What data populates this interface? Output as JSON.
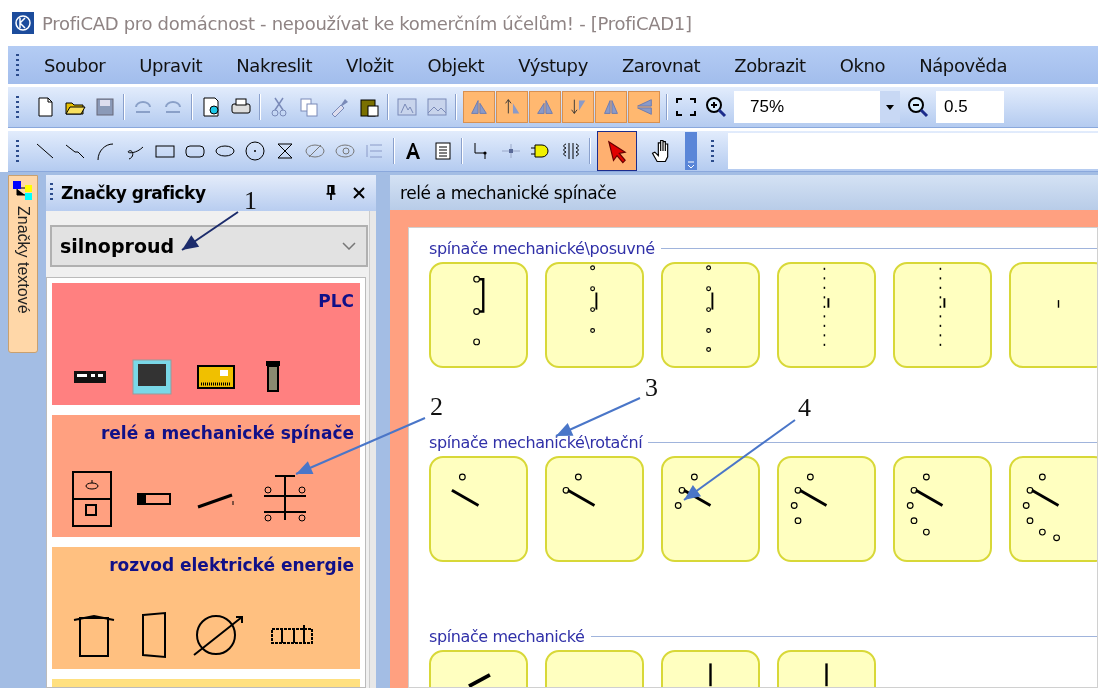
{
  "window": {
    "title": "ProfiCAD pro domácnost - nepoužívat ke komerčním účelům! - [ProfiCAD1]"
  },
  "menu": [
    "Soubor",
    "Upravit",
    "Nakreslit",
    "Vložit",
    "Objekt",
    "Výstupy",
    "Zarovnat",
    "Zobrazit",
    "Okno",
    "Nápověda"
  ],
  "zoom_combo": {
    "value": "75%"
  },
  "scale_field": {
    "value": "0.5"
  },
  "drawing_tools": [
    {
      "kind": "pointer",
      "selected": true
    },
    {
      "kind": "hand",
      "selected": false
    }
  ],
  "side_tab": {
    "label": "Značky textové"
  },
  "panel": {
    "title": "Značky graficky",
    "category_select": {
      "value": "silnoproud"
    },
    "groups": [
      {
        "label": "PLC",
        "color": "#ff8080",
        "kind": "plc"
      },
      {
        "label": "relé a mechanické spínače",
        "color": "#ffa080",
        "kind": "relay"
      },
      {
        "label": "rozvod elektrické energie",
        "color": "#ffc080",
        "kind": "power"
      },
      {
        "color": "#ffe080",
        "kind": "empty"
      }
    ]
  },
  "document": {
    "title": "relé a mechanické spínače",
    "sections": [
      {
        "label": "spínače mechanické\\posuvné",
        "symbols": [
          {
            "kind": "bridge"
          },
          {
            "kind": "slide"
          },
          {
            "kind": "slide2"
          },
          {
            "kind": "dotted"
          },
          {
            "kind": "dotted"
          },
          {
            "kind": "tick"
          }
        ]
      },
      {
        "label": "spínače mechanické\\rotační",
        "symbols": [
          {
            "kind": "rot1"
          },
          {
            "kind": "rot2"
          },
          {
            "kind": "rot3"
          },
          {
            "kind": "rot4"
          },
          {
            "kind": "rot5"
          },
          {
            "kind": "rot6"
          }
        ]
      },
      {
        "label": "spínače mechanické",
        "symbols": [
          {
            "kind": "lever"
          },
          {
            "kind": "blank"
          },
          {
            "kind": "post"
          },
          {
            "kind": "post"
          }
        ]
      }
    ]
  },
  "annotations": [
    {
      "label": "1"
    },
    {
      "label": "2"
    },
    {
      "label": "3"
    },
    {
      "label": "4"
    }
  ]
}
